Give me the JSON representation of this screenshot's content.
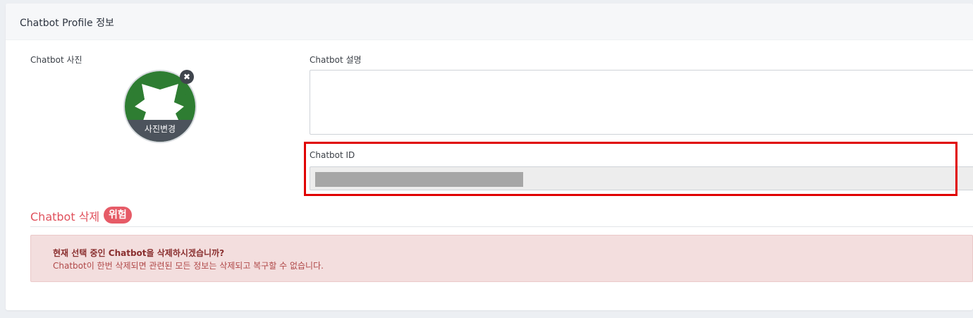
{
  "header": {
    "title": "Chatbot Profile 정보"
  },
  "photo": {
    "label": "Chatbot 사진",
    "change_label": "사진변경",
    "remove_icon": "✖"
  },
  "description": {
    "label": "Chatbot 설명",
    "value": ""
  },
  "chatbot_id": {
    "label": "Chatbot ID"
  },
  "danger": {
    "title": "Chatbot 삭제",
    "badge": "위험",
    "alert_title": "현재 선택 중인 Chatbot을 삭제하시겠습니까?",
    "alert_text": "Chatbot이 한번 삭제되면 관련된 모든 정보는 삭제되고 복구할 수 없습니다."
  },
  "colors": {
    "danger": "#e0515c",
    "highlight": "#e00000",
    "logo_green": "#2e7d32"
  }
}
